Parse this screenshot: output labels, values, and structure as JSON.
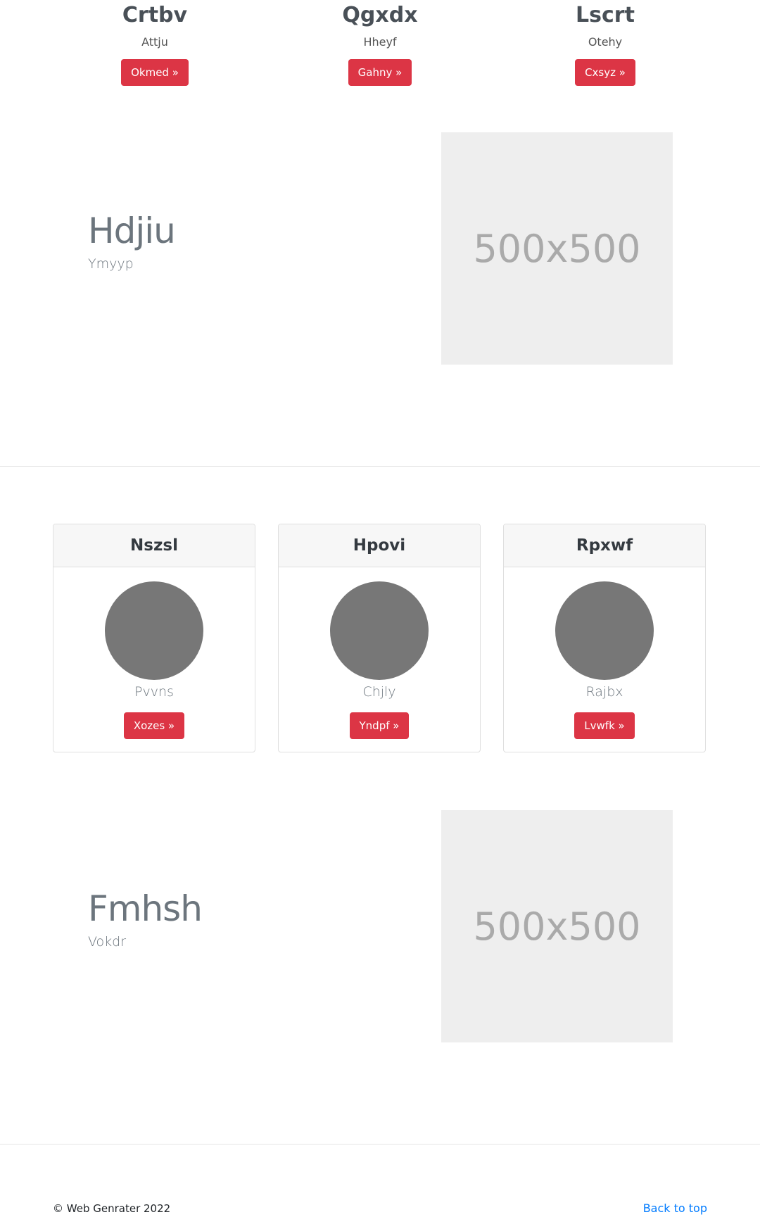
{
  "features": [
    {
      "title": "Crtbv",
      "text": "Attju",
      "button": "Okmed »"
    },
    {
      "title": "Qgxdx",
      "text": "Hheyf",
      "button": "Gahny »"
    },
    {
      "title": "Lscrt",
      "text": "Otehy",
      "button": "Cxsyz »"
    }
  ],
  "featurettes": [
    {
      "heading": "Hdjiu",
      "lead": "Ymyyp",
      "image_label": "500x500"
    },
    {
      "heading": "Fmhsh",
      "lead": "Vokdr",
      "image_label": "500x500"
    }
  ],
  "cards": [
    {
      "title": "Nszsl",
      "text": "Pvvns",
      "button": "Xozes »"
    },
    {
      "title": "Hpovi",
      "text": "Chjly",
      "button": "Yndpf »"
    },
    {
      "title": "Rpxwf",
      "text": "Rajbx",
      "button": "Lvwfk »"
    }
  ],
  "footer": {
    "copyright": "© Web Genrater 2022",
    "back_to_top": "Back to top"
  },
  "colors": {
    "button_bg": "#dc3545",
    "link": "#007bff",
    "avatar": "#777777",
    "placeholder_bg": "#eeeeee"
  }
}
